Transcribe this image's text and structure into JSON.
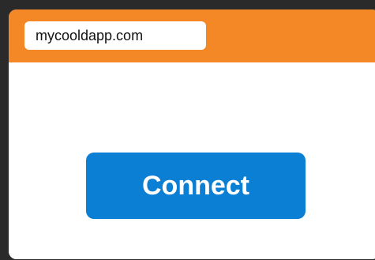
{
  "address_bar": {
    "url": "mycooldapp.com"
  },
  "main": {
    "connect_label": "Connect"
  },
  "colors": {
    "page_background": "#2a2a2a",
    "header": "#f48826",
    "button": "#0b7fd4",
    "button_text": "#ffffff"
  }
}
